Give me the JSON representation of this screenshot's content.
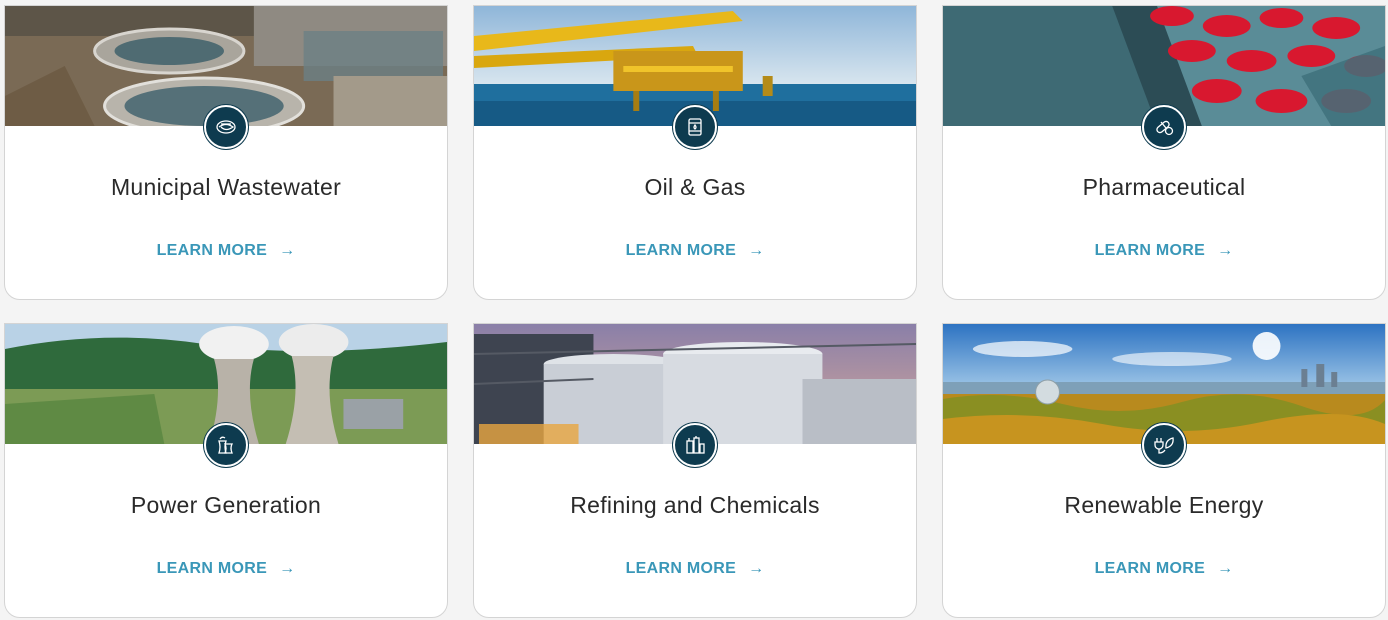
{
  "cards": [
    {
      "title": "Municipal Wastewater",
      "link_label": "LEARN MORE",
      "arrow": "→",
      "image": "wastewater-treatment-tanks",
      "icon": "water-coil-icon"
    },
    {
      "title": "Oil & Gas",
      "link_label": "LEARN MORE",
      "arrow": "→",
      "image": "offshore-oil-platform",
      "icon": "oil-barrel-icon"
    },
    {
      "title": "Pharmaceutical",
      "link_label": "LEARN MORE",
      "arrow": "→",
      "image": "red-pills",
      "icon": "pills-icon"
    },
    {
      "title": "Power Generation",
      "link_label": "LEARN MORE",
      "arrow": "→",
      "image": "cooling-towers",
      "icon": "power-plant-icon"
    },
    {
      "title": "Refining and Chemicals",
      "link_label": "LEARN MORE",
      "arrow": "→",
      "image": "refinery-tanks",
      "icon": "refinery-icon"
    },
    {
      "title": "Renewable Energy",
      "link_label": "LEARN MORE",
      "arrow": "→",
      "image": "forest-city-skyline",
      "icon": "plug-leaf-icon"
    }
  ],
  "colors": {
    "badge": "#0e3b4f",
    "link": "#3a97b8",
    "title": "#2a2a2a"
  }
}
